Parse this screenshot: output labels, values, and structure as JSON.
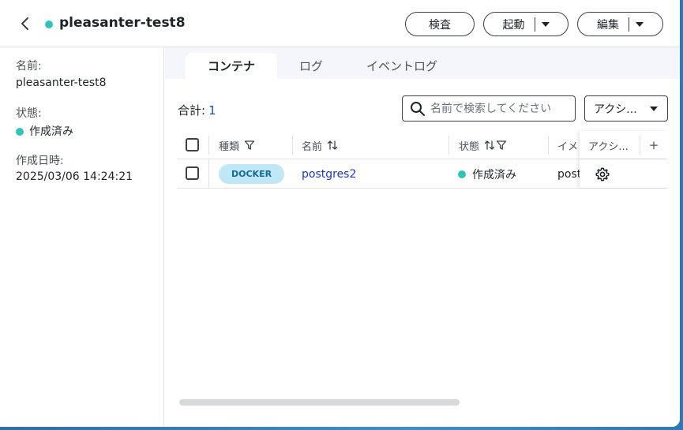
{
  "header": {
    "title": "pleasanter-test8",
    "status_color": "#2ec4b6",
    "buttons": {
      "inspect": "検査",
      "start": "起動",
      "edit": "編集"
    }
  },
  "sidebar": {
    "name_label": "名前:",
    "name_value": "pleasanter-test8",
    "state_label": "状態:",
    "state_value": "作成済み",
    "created_label": "作成日時:",
    "created_value": "2025/03/06 14:24:21"
  },
  "tabs": [
    {
      "label": "コンテナ",
      "active": true
    },
    {
      "label": "ログ",
      "active": false
    },
    {
      "label": "イベントログ",
      "active": false
    }
  ],
  "toolbar": {
    "total_label": "合計:",
    "total_count": "1",
    "search_placeholder": "名前で検索してください",
    "action_label": "アクシ..."
  },
  "table": {
    "columns": {
      "type": "種類",
      "name": "名前",
      "state": "状態",
      "image": "イメ",
      "action": "アクシ...",
      "add": "+"
    },
    "rows": [
      {
        "type": "DOCKER",
        "name": "postgres2",
        "state": "作成済み",
        "image": "post"
      }
    ]
  },
  "colors": {
    "accent_dot": "#2ec4b6",
    "link": "#1a33d6",
    "badge_bg": "#bfe7f6",
    "badge_text": "#136b8f"
  }
}
